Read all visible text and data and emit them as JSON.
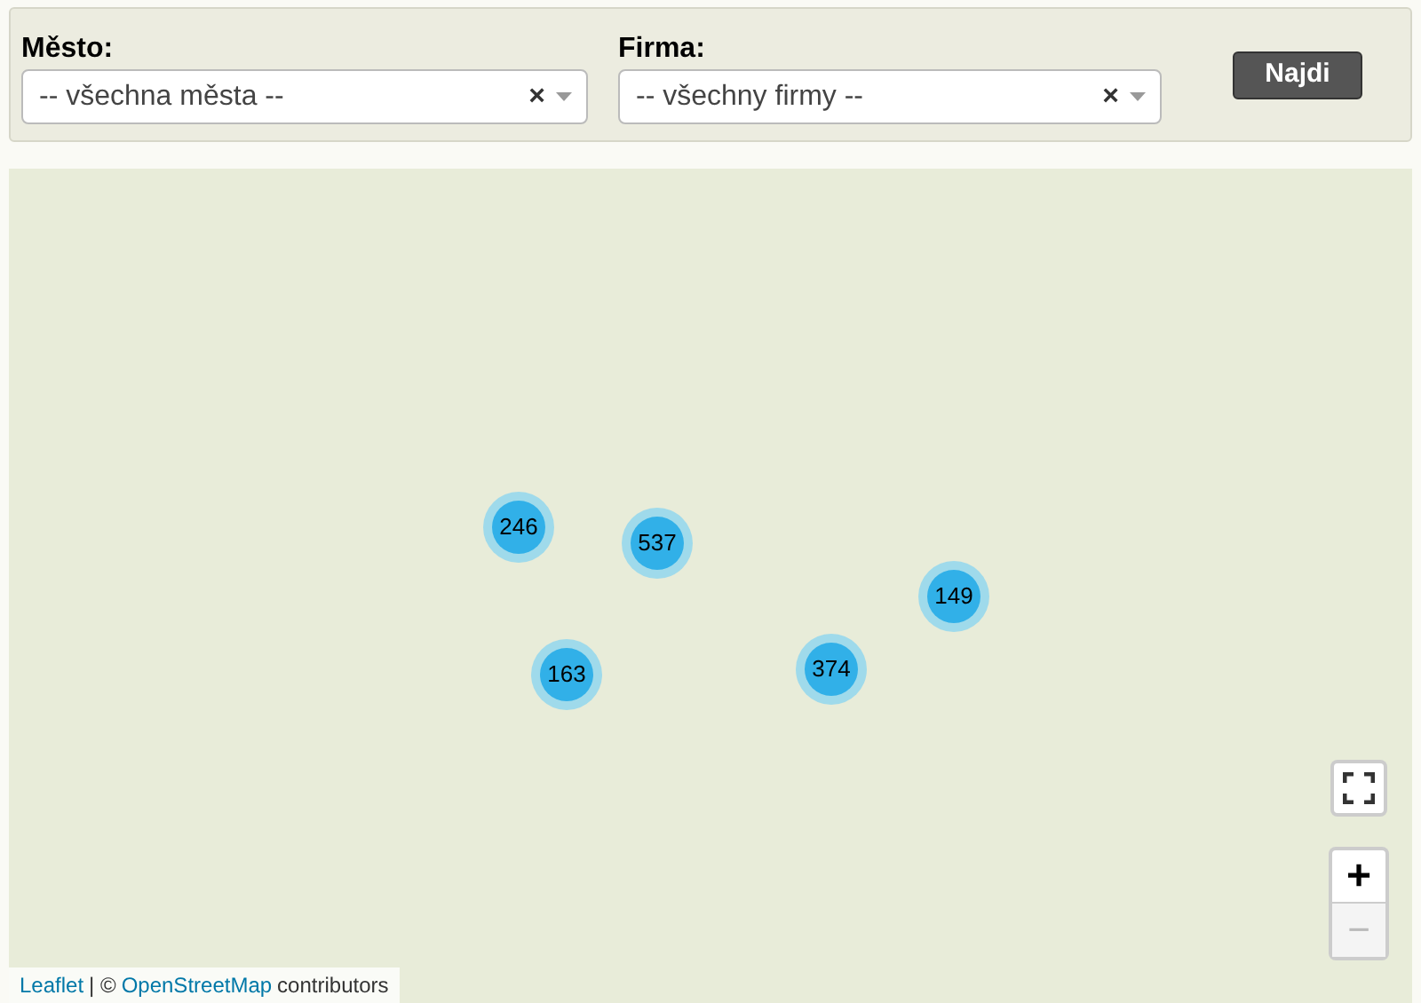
{
  "filters": [
    {
      "label": "Město:",
      "value": "-- všechna města --",
      "clear": "×"
    },
    {
      "label": "Firma:",
      "value": "-- všechny firmy --",
      "clear": "×"
    }
  ],
  "search_button": "Najdi",
  "map": {
    "clusters": [
      {
        "count": "246"
      },
      {
        "count": "537"
      },
      {
        "count": "163"
      },
      {
        "count": "374"
      },
      {
        "count": "149"
      }
    ],
    "zoom_in": "+",
    "zoom_out": "−",
    "zoom_out_disabled": true,
    "attribution": {
      "leaflet": "Leaflet",
      "separator": "| ©",
      "osm": "OpenStreetMap",
      "suffix": "contributors"
    }
  }
}
